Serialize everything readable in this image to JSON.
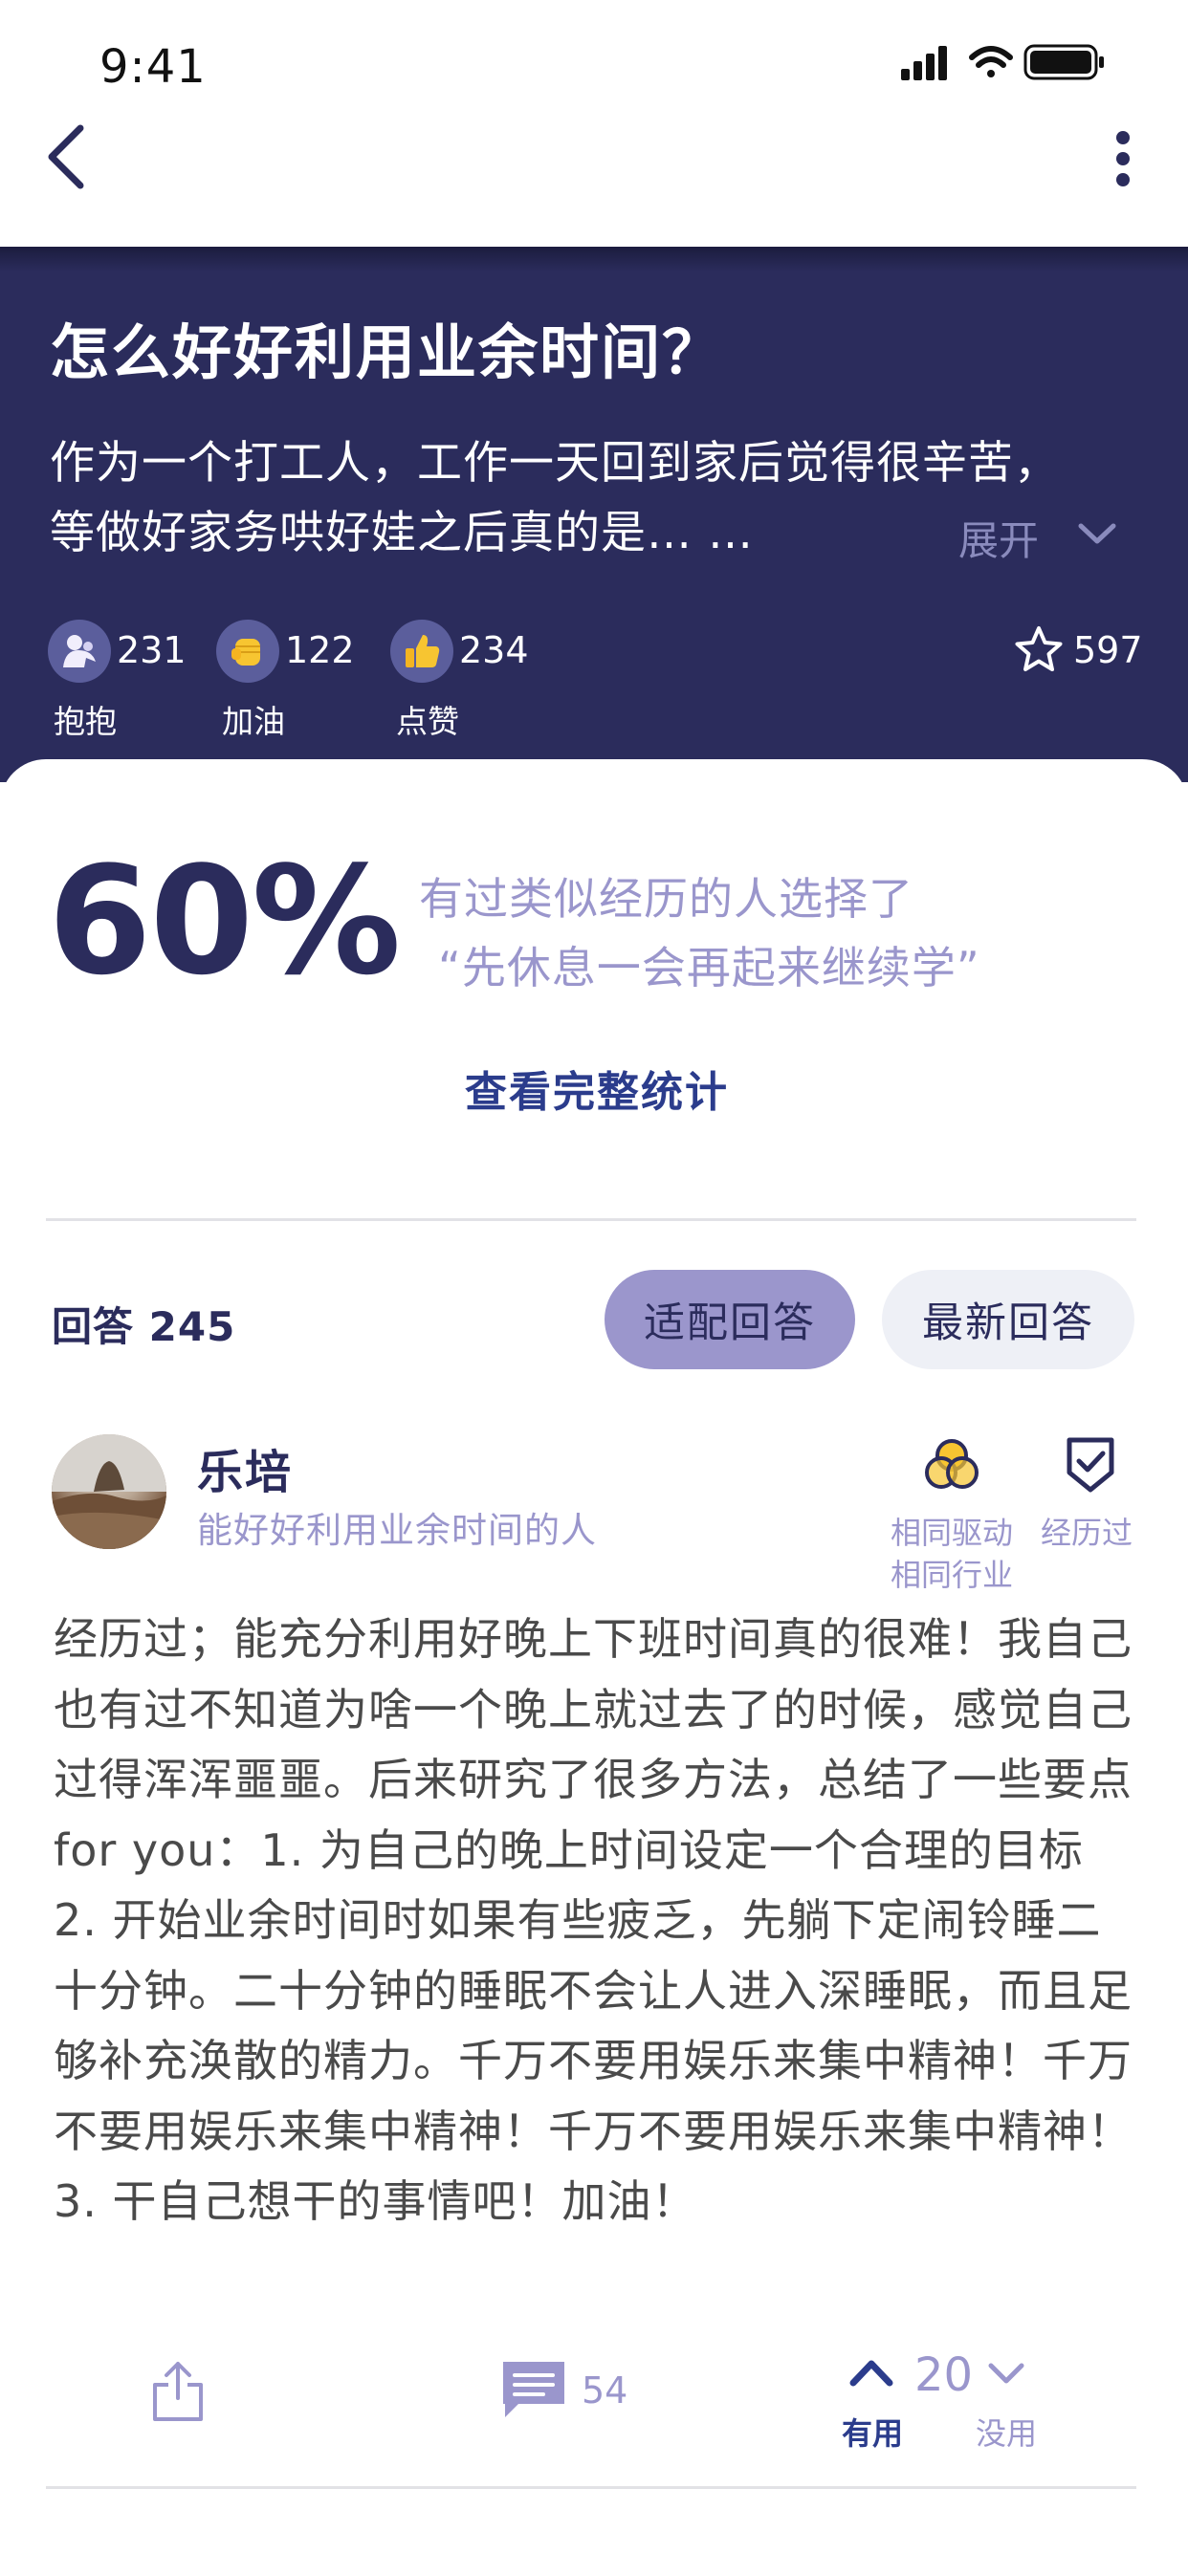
{
  "status_bar": {
    "time": "9:41"
  },
  "question": {
    "title": "怎么好好利用业余时间？",
    "description": "作为一个打工人，工作一天回到家后觉得很辛苦，等做好家务哄好娃之后真的是… …",
    "expand_label": "展开"
  },
  "reactions": [
    {
      "icon": "hug-icon",
      "count": "231",
      "label": "抱抱"
    },
    {
      "icon": "fist-icon",
      "count": "122",
      "label": "加油"
    },
    {
      "icon": "thumbs-up-icon",
      "count": "234",
      "label": "点赞"
    }
  ],
  "favorite": {
    "icon": "star-icon",
    "count": "597"
  },
  "stats": {
    "percent": "60%",
    "line1": "有过类似经历的人选择了",
    "line2": "“先休息一会再起来继续学”",
    "link": "查看完整统计"
  },
  "answers": {
    "title": "回答 245",
    "tabs": [
      "适配回答",
      "最新回答"
    ],
    "active_tab": "适配回答"
  },
  "answer": {
    "author": "乐培",
    "bio": "能好好利用业余时间的人",
    "badges": {
      "drive_line1": "相同驱动",
      "drive_line2": "相同行业",
      "experienced": "经历过"
    },
    "body": "经历过；能充分利用好晚上下班时间真的很难！我自己也有过不知道为啥一个晚上就过去了的时候，感觉自己过得浑浑噩噩。后来研究了很多方法，总结了一些要点for you：1. 为自己的晚上时间设定一个合理的目标 2. 开始业余时间时如果有些疲乏，先躺下定闹铃睡二十分钟。二十分钟的睡眠不会让人进入深睡眠，而且足够补充涣散的精力。千万不要用娱乐来集中精神！千万不要用娱乐来集中精神！千万不要用娱乐来集中精神！3. 干自己想干的事情吧！加油！",
    "comment_count": "54",
    "vote_count": "20",
    "useful_label": "有用",
    "useless_label": "没用"
  },
  "colors": {
    "header_bg": "#2b2c5c",
    "accent_lavender": "#9b96cc",
    "link_blue": "#2b3c8c"
  }
}
